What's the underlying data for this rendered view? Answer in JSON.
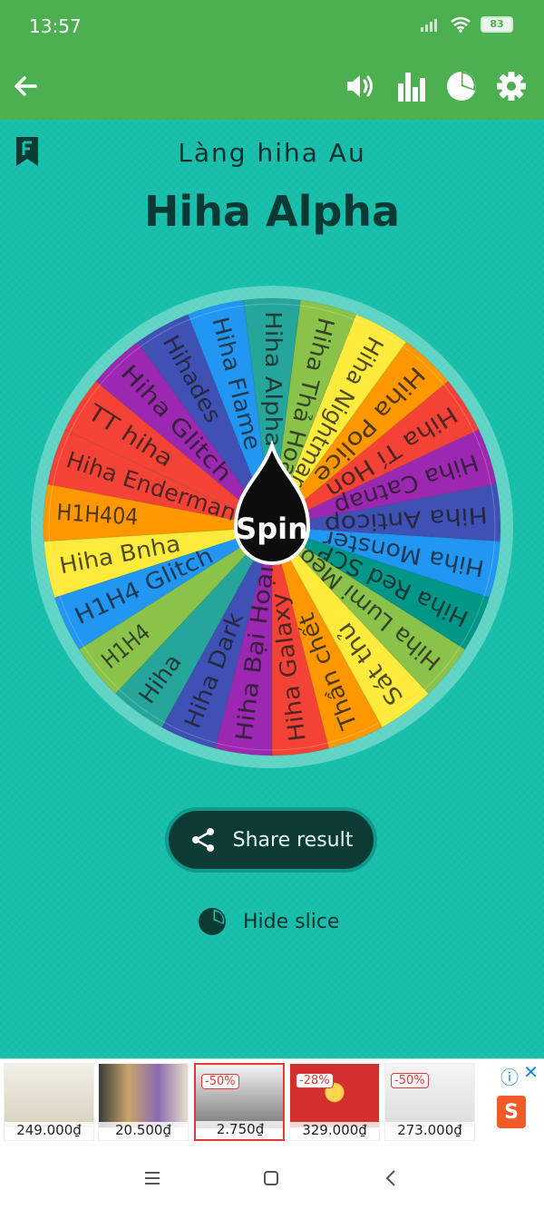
{
  "status_bar": {
    "time": "13:57",
    "battery": "83"
  },
  "header": {
    "subtitle": "Làng hiha Au",
    "title": "Hiha Alpha"
  },
  "wheel": {
    "center_label": "Spin",
    "slices": [
      {
        "label": "Hiha Alpha",
        "color": "#26a69a"
      },
      {
        "label": "Hiha Thả Hoa",
        "color": "#8bc34a"
      },
      {
        "label": "Hiha Nightmare",
        "color": "#ffeb3b"
      },
      {
        "label": "Hiha Police",
        "color": "#ff9800"
      },
      {
        "label": "Hiha Tí Hon",
        "color": "#f44336"
      },
      {
        "label": "Hiha Catnap",
        "color": "#9c27b0"
      },
      {
        "label": "Hiha Anticop",
        "color": "#3f51b5"
      },
      {
        "label": "Hiha Monster",
        "color": "#2196f3"
      },
      {
        "label": "Hiha Red SCP",
        "color": "#009688"
      },
      {
        "label": "Hiha Lumi Mẹo",
        "color": "#8bc34a"
      },
      {
        "label": "Sát thủ",
        "color": "#ffeb3b"
      },
      {
        "label": "Thần chết",
        "color": "#ff9800"
      },
      {
        "label": "Hiha Galaxy",
        "color": "#f44336"
      },
      {
        "label": "Hiha Bại Hoại",
        "color": "#9c27b0"
      },
      {
        "label": "Hiha Dark",
        "color": "#3f51b5"
      },
      {
        "label": "Hiha",
        "color": "#26a69a"
      },
      {
        "label": "H1H4",
        "color": "#8bc34a"
      },
      {
        "label": "H1H4 Glitch",
        "color": "#2196f3"
      },
      {
        "label": "Hiha Bnha",
        "color": "#ffeb3b"
      },
      {
        "label": "H1H404",
        "color": "#ff9800"
      },
      {
        "label": "Hiha Enderman",
        "color": "#f44336"
      },
      {
        "label": "TT hiha",
        "color": "#f44336"
      },
      {
        "label": "Hiha Glitch",
        "color": "#9c27b0"
      },
      {
        "label": "Hihades",
        "color": "#3f51b5"
      },
      {
        "label": "Hiha Flame",
        "color": "#2196f3"
      }
    ]
  },
  "actions": {
    "share_label": "Share result",
    "hide_slice_label": "Hide slice"
  },
  "ads": [
    {
      "price": "249.000₫",
      "badge": ""
    },
    {
      "price": "20.500₫",
      "badge": ""
    },
    {
      "price": "2.750₫",
      "badge": "-50%"
    },
    {
      "price": "329.000₫",
      "badge": "-28%"
    },
    {
      "price": "273.000₫",
      "badge": "-50%"
    }
  ],
  "ads_meta": {
    "store_logo": "S",
    "info_icon": "ⓘ",
    "close_icon": "✕"
  }
}
